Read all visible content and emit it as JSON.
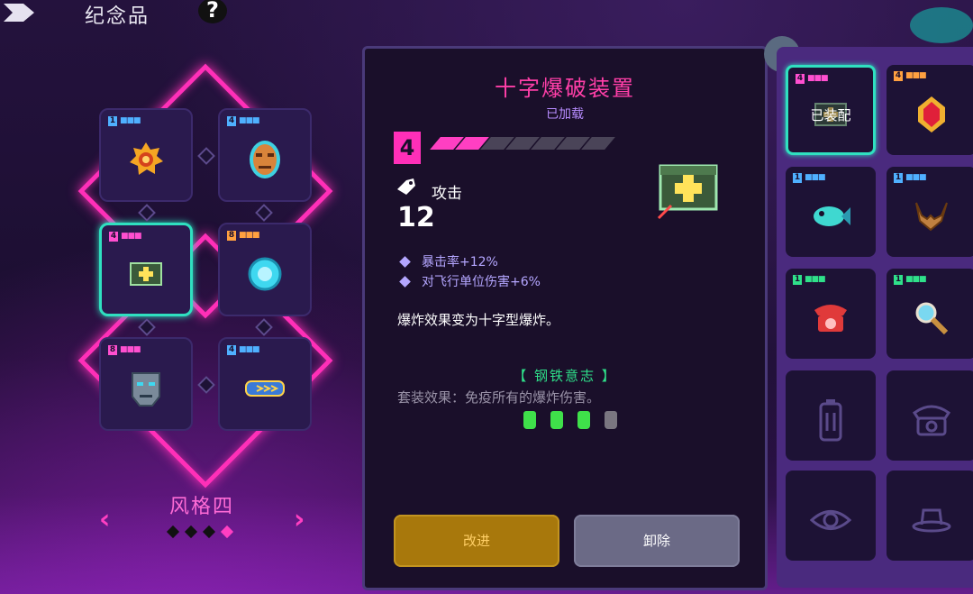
{
  "header": {
    "title": "纪念品",
    "help_label": "?"
  },
  "style_selector": {
    "label": "风格四",
    "prev": "‹",
    "next": "›",
    "pages": 4,
    "current": 4
  },
  "slots": [
    {
      "tier": "1",
      "tier_color": "#4fb0ff",
      "icon": "sun-medallion-icon"
    },
    {
      "tier": "4",
      "tier_color": "#4fb0ff",
      "icon": "tribal-mask-icon"
    },
    {
      "tier": "4",
      "tier_color": "#ff4fd0",
      "icon": "cross-blast-device-icon",
      "selected": true
    },
    {
      "tier": "8",
      "tier_color": "#ffa040",
      "icon": "cyan-gear-icon"
    },
    {
      "tier": "8",
      "tier_color": "#ff4fd0",
      "icon": "robot-mask-icon"
    },
    {
      "tier": "4",
      "tier_color": "#4fb0ff",
      "icon": "cassette-icon"
    }
  ],
  "detail": {
    "title": "十字爆破装置",
    "status": "已加载",
    "level": "4",
    "pips_filled": 2,
    "pips_total": 7,
    "attack_label": "攻击",
    "attack_value": "12",
    "stats": [
      "暴击率+12%",
      "对飞行单位伤害+6%"
    ],
    "description": "爆炸效果变为十字型爆炸。",
    "set_name": "【 钢铁意志 】",
    "set_effect": "套装效果：免疫所有的爆炸伤害。",
    "set_progress": {
      "active": 3,
      "total": 4
    },
    "upgrade_button": "改进",
    "unequip_button": "卸除"
  },
  "inventory": {
    "equipped_label": "已装配",
    "items": [
      {
        "tier": "4",
        "tier_color": "#ff4fd0",
        "icon": "cross-blast-device-icon",
        "equipped": true
      },
      {
        "tier": "4",
        "tier_color": "#ffa040",
        "icon": "ruby-amulet-icon"
      },
      {
        "tier": "1",
        "tier_color": "#4fb0ff",
        "icon": "blue-fish-icon"
      },
      {
        "tier": "1",
        "tier_color": "#4fb0ff",
        "icon": "antlers-icon"
      },
      {
        "tier": "1",
        "tier_color": "#2fe08a",
        "icon": "red-telephone-icon"
      },
      {
        "tier": "1",
        "tier_color": "#2fe08a",
        "icon": "magnifier-icon"
      },
      {
        "tier": "",
        "icon": "locked-battery-icon"
      },
      {
        "tier": "",
        "icon": "locked-telephone-icon"
      },
      {
        "tier": "",
        "icon": "locked-eye-icon"
      },
      {
        "tier": "",
        "icon": "locked-hat-icon"
      }
    ]
  },
  "colors": {
    "accent_pink": "#ff2fb8",
    "teal": "#2fe0c0",
    "set_green": "#2fe08a",
    "panel": "#1a0f2a"
  }
}
